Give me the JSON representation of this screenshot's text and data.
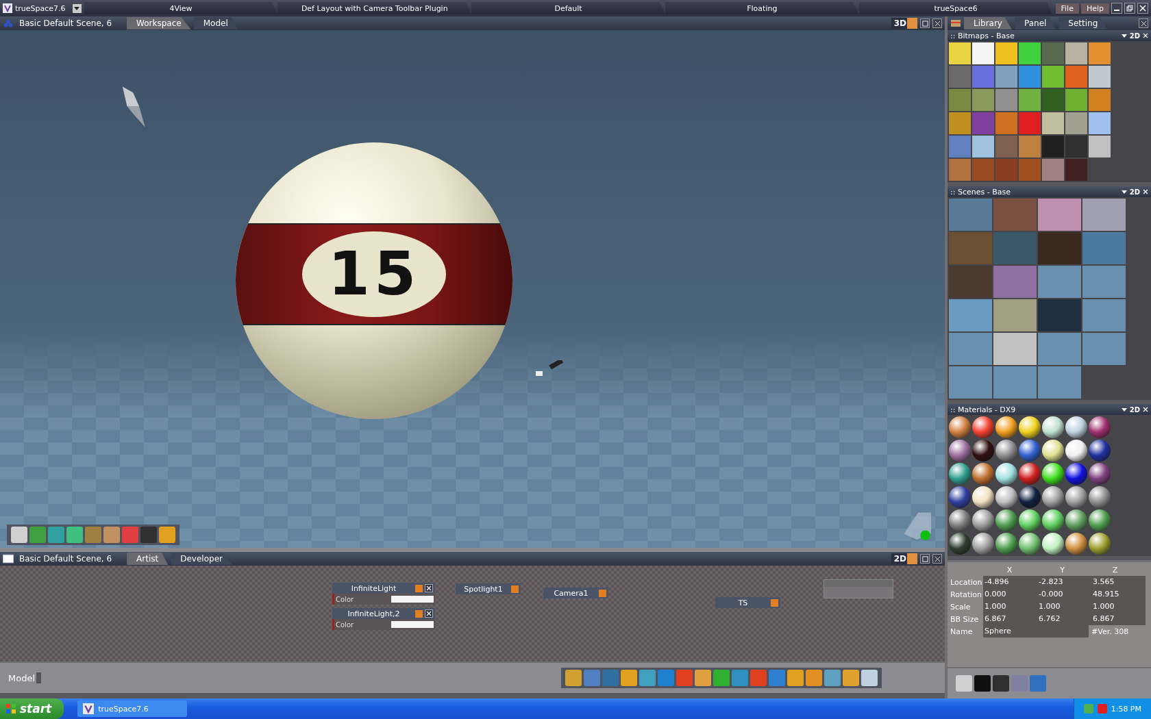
{
  "title_bar": {
    "app_title": "trueSpace7.6",
    "layouts": [
      {
        "label": "4View"
      },
      {
        "label": "Def Layout with Camera Toolbar Plugin"
      },
      {
        "label": "Default"
      },
      {
        "label": "Floating"
      },
      {
        "label": "trueSpace6"
      }
    ],
    "menus": [
      "File",
      "Help"
    ]
  },
  "viewport": {
    "title": "Basic Default Scene, 6",
    "tabs": [
      {
        "label": "Workspace",
        "selected": true
      },
      {
        "label": "Model",
        "selected": false
      }
    ],
    "mode": "3D",
    "ball_number": "15"
  },
  "library": {
    "tabs": [
      {
        "label": "Library",
        "selected": true
      },
      {
        "label": "Panel",
        "selected": false
      },
      {
        "label": "Setting",
        "selected": false
      }
    ],
    "sections": [
      {
        "title": ":: Bitmaps - Base",
        "mode": "2D",
        "kind": "bitmaps",
        "thumbnails": [
          {
            "kind": "image"
          },
          {
            "kind": "image"
          },
          {
            "kind": "image"
          },
          {
            "kind": "image"
          },
          {
            "kind": "image"
          },
          {
            "kind": "image"
          },
          {
            "kind": "image"
          },
          {
            "kind": "image"
          },
          {
            "kind": "image"
          },
          {
            "kind": "image"
          },
          {
            "kind": "image"
          },
          {
            "kind": "image"
          },
          {
            "kind": "image"
          },
          {
            "kind": "image"
          },
          {
            "kind": "image"
          },
          {
            "kind": "image"
          },
          {
            "kind": "image"
          },
          {
            "kind": "image"
          },
          {
            "kind": "image"
          },
          {
            "kind": "image"
          },
          {
            "kind": "image"
          },
          {
            "kind": "image"
          },
          {
            "kind": "image"
          },
          {
            "kind": "image"
          },
          {
            "kind": "image"
          },
          {
            "kind": "image"
          },
          {
            "kind": "image"
          },
          {
            "kind": "image"
          },
          {
            "kind": "image"
          },
          {
            "kind": "image"
          },
          {
            "kind": "image"
          },
          {
            "kind": "image"
          },
          {
            "kind": "image"
          },
          {
            "kind": "image"
          },
          {
            "kind": "image"
          },
          {
            "kind": "image"
          },
          {
            "kind": "image"
          },
          {
            "kind": "image"
          },
          {
            "kind": "image"
          },
          {
            "kind": "image"
          },
          {
            "kind": "image"
          }
        ]
      },
      {
        "title": ":: Scenes - Base",
        "mode": "2D",
        "kind": "scenes",
        "thumbnails": [
          {
            "kind": "image"
          },
          {
            "kind": "image"
          },
          {
            "kind": "image"
          },
          {
            "kind": "image"
          },
          {
            "kind": "image"
          },
          {
            "kind": "image"
          },
          {
            "kind": "image"
          },
          {
            "kind": "image"
          },
          {
            "kind": "image"
          },
          {
            "kind": "image"
          },
          {
            "kind": "image"
          },
          {
            "kind": "image"
          },
          {
            "kind": "image"
          },
          {
            "kind": "image"
          },
          {
            "kind": "image"
          },
          {
            "kind": "image"
          },
          {
            "kind": "image"
          },
          {
            "kind": "image"
          },
          {
            "kind": "image"
          },
          {
            "kind": "image"
          },
          {
            "kind": "image"
          },
          {
            "kind": "image"
          },
          {
            "kind": "image"
          }
        ]
      },
      {
        "title": ":: Materials - DX9",
        "mode": "2D",
        "kind": "materials",
        "thumbnails": [
          {
            "kind": "sphere"
          },
          {
            "kind": "sphere"
          },
          {
            "kind": "sphere"
          },
          {
            "kind": "sphere"
          },
          {
            "kind": "sphere"
          },
          {
            "kind": "sphere"
          },
          {
            "kind": "sphere"
          },
          {
            "kind": "sphere"
          },
          {
            "kind": "sphere"
          },
          {
            "kind": "sphere"
          },
          {
            "kind": "sphere"
          },
          {
            "kind": "sphere"
          },
          {
            "kind": "sphere"
          },
          {
            "kind": "sphere"
          },
          {
            "kind": "sphere"
          },
          {
            "kind": "sphere"
          },
          {
            "kind": "sphere"
          },
          {
            "kind": "sphere"
          },
          {
            "kind": "sphere"
          },
          {
            "kind": "sphere"
          },
          {
            "kind": "sphere"
          },
          {
            "kind": "sphere"
          },
          {
            "kind": "sphere"
          },
          {
            "kind": "sphere"
          },
          {
            "kind": "sphere"
          },
          {
            "kind": "sphere"
          },
          {
            "kind": "sphere"
          },
          {
            "kind": "sphere"
          },
          {
            "kind": "sphere"
          },
          {
            "kind": "sphere"
          },
          {
            "kind": "sphere"
          },
          {
            "kind": "sphere"
          },
          {
            "kind": "sphere"
          },
          {
            "kind": "sphere"
          },
          {
            "kind": "sphere"
          },
          {
            "kind": "sphere"
          },
          {
            "kind": "sphere"
          },
          {
            "kind": "sphere"
          },
          {
            "kind": "sphere"
          },
          {
            "kind": "sphere"
          },
          {
            "kind": "sphere"
          },
          {
            "kind": "sphere"
          }
        ]
      }
    ]
  },
  "node_editor": {
    "title": "Basic Default Scene, 6",
    "tabs": [
      {
        "label": "Artist",
        "selected": true
      },
      {
        "label": "Developer",
        "selected": false
      }
    ],
    "mode": "2D",
    "nodes": [
      {
        "label": "InfiniteLight",
        "ports": [
          "Color"
        ],
        "closable": true
      },
      {
        "label": "InfiniteLight,2",
        "ports": [
          "Color"
        ],
        "closable": true
      },
      {
        "label": "Spotlight1",
        "closable": false
      },
      {
        "label": "Camera1",
        "closable": false
      },
      {
        "label": "TS",
        "closable": false
      }
    ]
  },
  "properties": {
    "columns": [
      "X",
      "Y",
      "Z"
    ],
    "rows": [
      {
        "label": "Location",
        "values": [
          "-4.896",
          "-2.823",
          "3.565"
        ]
      },
      {
        "label": "Rotation",
        "values": [
          "0.000",
          "-0.000",
          "48.915"
        ]
      },
      {
        "label": "Scale",
        "values": [
          "1.000",
          "1.000",
          "1.000"
        ]
      },
      {
        "label": "BB Size",
        "values": [
          "6.867",
          "6.762",
          "6.867"
        ]
      }
    ],
    "name_label": "Name",
    "name_value": "Sphere",
    "version": "#Ver. 308"
  },
  "status_bar": {
    "mode": "Model"
  },
  "taskbar": {
    "start": "start",
    "task": "trueSpace7.6",
    "clock": "1:58 PM"
  }
}
